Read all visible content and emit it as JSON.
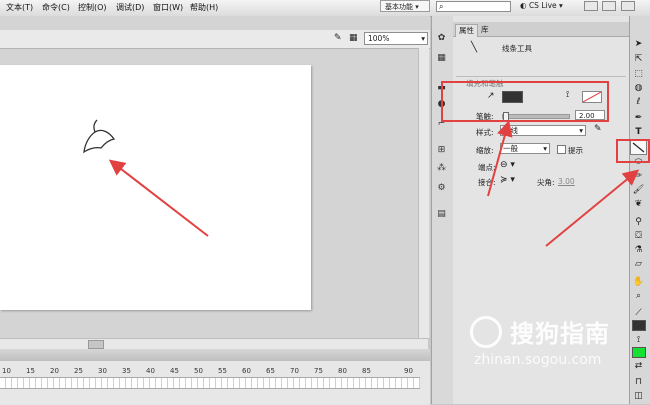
{
  "menubar": {
    "items": [
      "文本(T)",
      "命令(C)",
      "控制(O)",
      "调试(D)",
      "窗口(W)",
      "帮助(H)"
    ],
    "workspace": "基本功能",
    "search_placeholder": "",
    "cs_live": "CS Live"
  },
  "stage": {
    "zoom": "100%"
  },
  "timeline": {
    "frame_numbers": [
      "10",
      "15",
      "20",
      "25",
      "30",
      "35",
      "40",
      "45",
      "50",
      "55",
      "60",
      "65",
      "70",
      "75",
      "80",
      "85",
      "90"
    ]
  },
  "properties": {
    "tabs": [
      "属性",
      "库"
    ],
    "tool_name": "线条工具",
    "section_title": "填充和笔触",
    "stroke_label": "笔触:",
    "stroke_value": "2.00",
    "style_label": "样式:",
    "style_value": "实线",
    "scale_label": "缩放:",
    "scale_value": "一般",
    "hint_label": "提示",
    "cap_label": "端点:",
    "join_label": "接合:",
    "miter_label": "尖角:",
    "miter_value": "3.00"
  },
  "watermark": {
    "text": "搜狗指南",
    "url": "zhinan.sogou.com"
  },
  "colors": {
    "stroke_color": "#333333",
    "fill_color": "#16e031",
    "annotation_red": "#e24141"
  }
}
